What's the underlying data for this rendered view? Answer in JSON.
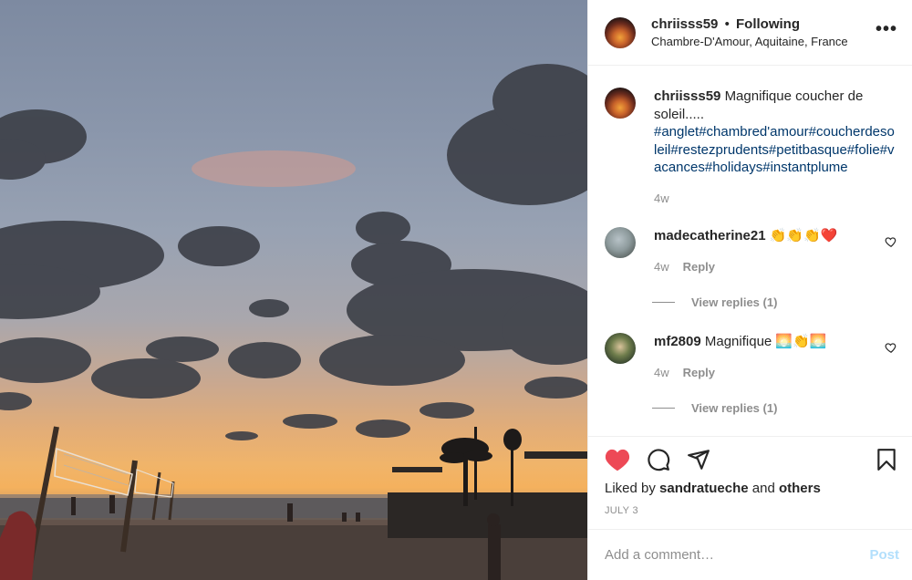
{
  "post": {
    "username": "chriisss59",
    "separator": "•",
    "follow_status": "Following",
    "location": "Chambre-D'Amour, Aquitaine, France",
    "more_label": "•••"
  },
  "caption": {
    "username": "chriisss59",
    "text": "Magnifique coucher de soleil.....",
    "hashtags": "#anglet#chambred'amour#coucherdesoleil#restezprudents#petitbasque#folie#vacances#holidays#instantplume",
    "time": "4w"
  },
  "comments": [
    {
      "username": "madecatherine21",
      "text": "👏👏👏❤️",
      "time": "4w",
      "reply_label": "Reply",
      "view_replies": "View replies (1)"
    },
    {
      "username": "mf2809",
      "text": "Magnifique 🌅👏🌅",
      "time": "4w",
      "reply_label": "Reply",
      "view_replies": "View replies (1)"
    }
  ],
  "likes": {
    "prefix": "Liked by",
    "user": "sandratueche",
    "conj": "and",
    "others": "others"
  },
  "date": "JULY 3",
  "add_comment": {
    "placeholder": "Add a comment…",
    "post_label": "Post"
  },
  "colors": {
    "like_red": "#ed4956",
    "hashtag_blue": "#00376b",
    "post_disabled": "#b2dffc",
    "muted": "#8e8e8e"
  },
  "icons": [
    "heart-filled-icon",
    "comment-icon",
    "share-icon",
    "bookmark-icon",
    "heart-outline-icon",
    "more-icon"
  ]
}
